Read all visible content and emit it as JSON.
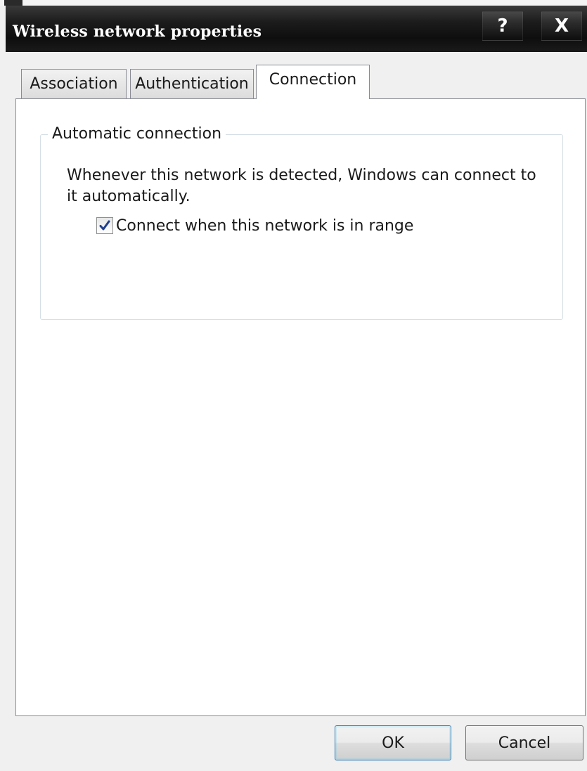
{
  "window": {
    "title": "Wireless network properties",
    "help_glyph": "?",
    "close_glyph": "X"
  },
  "tabs": [
    {
      "label": "Association",
      "selected": false
    },
    {
      "label": "Authentication",
      "selected": false
    },
    {
      "label": "Connection",
      "selected": true
    }
  ],
  "group": {
    "legend": "Automatic connection",
    "description": "Whenever this network is detected, Windows can connect to it automatically.",
    "checkbox": {
      "label": "Connect when this network is in range",
      "checked": true
    }
  },
  "buttons": {
    "ok_label": "OK",
    "cancel_label": "Cancel"
  },
  "colors": {
    "titlebar": "#111111",
    "checkmark": "#1f3f8f",
    "default_button_border": "#3c7fb1"
  },
  "icons": {
    "help": "help-icon",
    "close": "close-icon",
    "check": "checkmark-icon"
  }
}
